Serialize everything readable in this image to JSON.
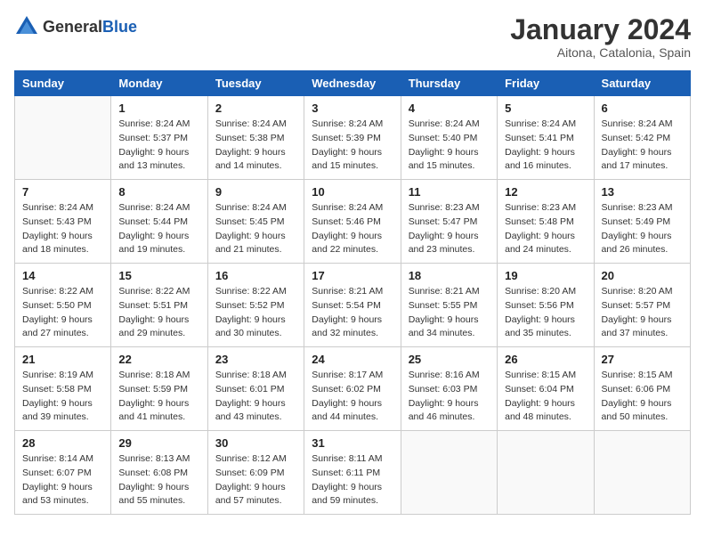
{
  "header": {
    "logo_general": "General",
    "logo_blue": "Blue",
    "title": "January 2024",
    "subtitle": "Aitona, Catalonia, Spain"
  },
  "weekdays": [
    "Sunday",
    "Monday",
    "Tuesday",
    "Wednesday",
    "Thursday",
    "Friday",
    "Saturday"
  ],
  "weeks": [
    [
      {
        "day": "",
        "sunrise": "",
        "sunset": "",
        "daylight": ""
      },
      {
        "day": "1",
        "sunrise": "Sunrise: 8:24 AM",
        "sunset": "Sunset: 5:37 PM",
        "daylight": "Daylight: 9 hours and 13 minutes."
      },
      {
        "day": "2",
        "sunrise": "Sunrise: 8:24 AM",
        "sunset": "Sunset: 5:38 PM",
        "daylight": "Daylight: 9 hours and 14 minutes."
      },
      {
        "day": "3",
        "sunrise": "Sunrise: 8:24 AM",
        "sunset": "Sunset: 5:39 PM",
        "daylight": "Daylight: 9 hours and 15 minutes."
      },
      {
        "day": "4",
        "sunrise": "Sunrise: 8:24 AM",
        "sunset": "Sunset: 5:40 PM",
        "daylight": "Daylight: 9 hours and 15 minutes."
      },
      {
        "day": "5",
        "sunrise": "Sunrise: 8:24 AM",
        "sunset": "Sunset: 5:41 PM",
        "daylight": "Daylight: 9 hours and 16 minutes."
      },
      {
        "day": "6",
        "sunrise": "Sunrise: 8:24 AM",
        "sunset": "Sunset: 5:42 PM",
        "daylight": "Daylight: 9 hours and 17 minutes."
      }
    ],
    [
      {
        "day": "7",
        "sunrise": "Sunrise: 8:24 AM",
        "sunset": "Sunset: 5:43 PM",
        "daylight": "Daylight: 9 hours and 18 minutes."
      },
      {
        "day": "8",
        "sunrise": "Sunrise: 8:24 AM",
        "sunset": "Sunset: 5:44 PM",
        "daylight": "Daylight: 9 hours and 19 minutes."
      },
      {
        "day": "9",
        "sunrise": "Sunrise: 8:24 AM",
        "sunset": "Sunset: 5:45 PM",
        "daylight": "Daylight: 9 hours and 21 minutes."
      },
      {
        "day": "10",
        "sunrise": "Sunrise: 8:24 AM",
        "sunset": "Sunset: 5:46 PM",
        "daylight": "Daylight: 9 hours and 22 minutes."
      },
      {
        "day": "11",
        "sunrise": "Sunrise: 8:23 AM",
        "sunset": "Sunset: 5:47 PM",
        "daylight": "Daylight: 9 hours and 23 minutes."
      },
      {
        "day": "12",
        "sunrise": "Sunrise: 8:23 AM",
        "sunset": "Sunset: 5:48 PM",
        "daylight": "Daylight: 9 hours and 24 minutes."
      },
      {
        "day": "13",
        "sunrise": "Sunrise: 8:23 AM",
        "sunset": "Sunset: 5:49 PM",
        "daylight": "Daylight: 9 hours and 26 minutes."
      }
    ],
    [
      {
        "day": "14",
        "sunrise": "Sunrise: 8:22 AM",
        "sunset": "Sunset: 5:50 PM",
        "daylight": "Daylight: 9 hours and 27 minutes."
      },
      {
        "day": "15",
        "sunrise": "Sunrise: 8:22 AM",
        "sunset": "Sunset: 5:51 PM",
        "daylight": "Daylight: 9 hours and 29 minutes."
      },
      {
        "day": "16",
        "sunrise": "Sunrise: 8:22 AM",
        "sunset": "Sunset: 5:52 PM",
        "daylight": "Daylight: 9 hours and 30 minutes."
      },
      {
        "day": "17",
        "sunrise": "Sunrise: 8:21 AM",
        "sunset": "Sunset: 5:54 PM",
        "daylight": "Daylight: 9 hours and 32 minutes."
      },
      {
        "day": "18",
        "sunrise": "Sunrise: 8:21 AM",
        "sunset": "Sunset: 5:55 PM",
        "daylight": "Daylight: 9 hours and 34 minutes."
      },
      {
        "day": "19",
        "sunrise": "Sunrise: 8:20 AM",
        "sunset": "Sunset: 5:56 PM",
        "daylight": "Daylight: 9 hours and 35 minutes."
      },
      {
        "day": "20",
        "sunrise": "Sunrise: 8:20 AM",
        "sunset": "Sunset: 5:57 PM",
        "daylight": "Daylight: 9 hours and 37 minutes."
      }
    ],
    [
      {
        "day": "21",
        "sunrise": "Sunrise: 8:19 AM",
        "sunset": "Sunset: 5:58 PM",
        "daylight": "Daylight: 9 hours and 39 minutes."
      },
      {
        "day": "22",
        "sunrise": "Sunrise: 8:18 AM",
        "sunset": "Sunset: 5:59 PM",
        "daylight": "Daylight: 9 hours and 41 minutes."
      },
      {
        "day": "23",
        "sunrise": "Sunrise: 8:18 AM",
        "sunset": "Sunset: 6:01 PM",
        "daylight": "Daylight: 9 hours and 43 minutes."
      },
      {
        "day": "24",
        "sunrise": "Sunrise: 8:17 AM",
        "sunset": "Sunset: 6:02 PM",
        "daylight": "Daylight: 9 hours and 44 minutes."
      },
      {
        "day": "25",
        "sunrise": "Sunrise: 8:16 AM",
        "sunset": "Sunset: 6:03 PM",
        "daylight": "Daylight: 9 hours and 46 minutes."
      },
      {
        "day": "26",
        "sunrise": "Sunrise: 8:15 AM",
        "sunset": "Sunset: 6:04 PM",
        "daylight": "Daylight: 9 hours and 48 minutes."
      },
      {
        "day": "27",
        "sunrise": "Sunrise: 8:15 AM",
        "sunset": "Sunset: 6:06 PM",
        "daylight": "Daylight: 9 hours and 50 minutes."
      }
    ],
    [
      {
        "day": "28",
        "sunrise": "Sunrise: 8:14 AM",
        "sunset": "Sunset: 6:07 PM",
        "daylight": "Daylight: 9 hours and 53 minutes."
      },
      {
        "day": "29",
        "sunrise": "Sunrise: 8:13 AM",
        "sunset": "Sunset: 6:08 PM",
        "daylight": "Daylight: 9 hours and 55 minutes."
      },
      {
        "day": "30",
        "sunrise": "Sunrise: 8:12 AM",
        "sunset": "Sunset: 6:09 PM",
        "daylight": "Daylight: 9 hours and 57 minutes."
      },
      {
        "day": "31",
        "sunrise": "Sunrise: 8:11 AM",
        "sunset": "Sunset: 6:11 PM",
        "daylight": "Daylight: 9 hours and 59 minutes."
      },
      {
        "day": "",
        "sunrise": "",
        "sunset": "",
        "daylight": ""
      },
      {
        "day": "",
        "sunrise": "",
        "sunset": "",
        "daylight": ""
      },
      {
        "day": "",
        "sunrise": "",
        "sunset": "",
        "daylight": ""
      }
    ]
  ]
}
